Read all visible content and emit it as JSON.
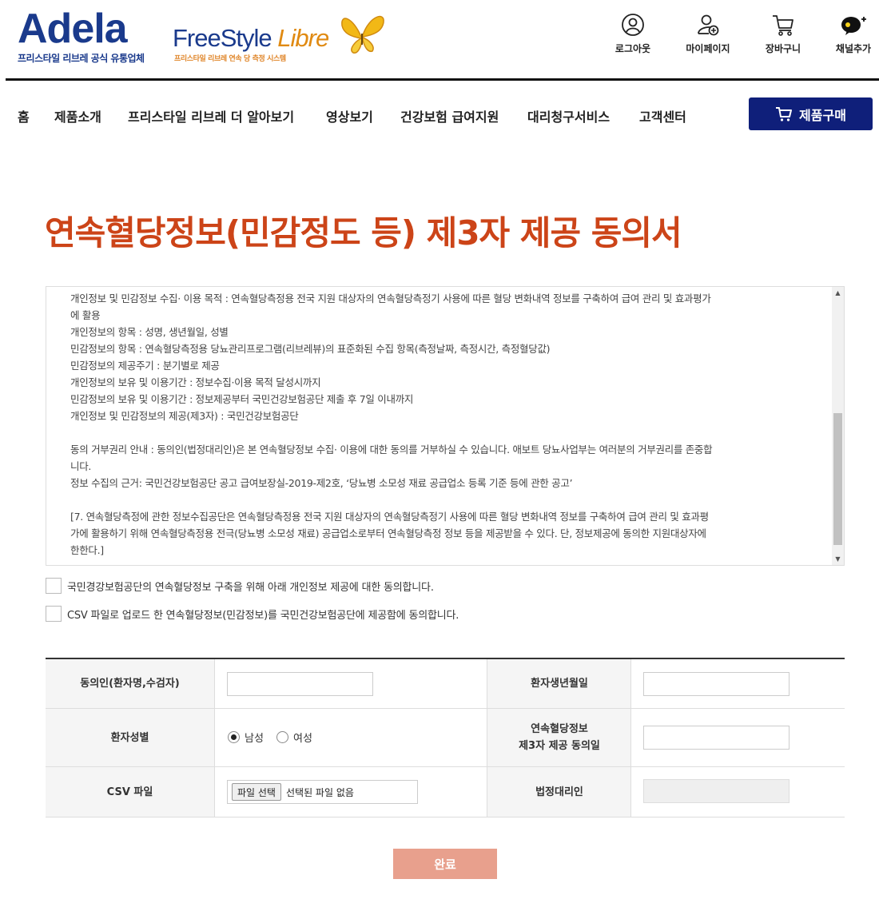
{
  "brand": {
    "adela_name": "Adela",
    "adela_tagline": "프리스타일 리브레 공식 유통업체",
    "libre_name": "FreeStyle",
    "libre_accent": "Libre",
    "libre_tagline": "프리스타일 리브레 연속 당 측정 시스템"
  },
  "utility": [
    {
      "label": "로그아웃",
      "icon": "user-icon"
    },
    {
      "label": "마이페이지",
      "icon": "user-plus-icon"
    },
    {
      "label": "장바구니",
      "icon": "cart-icon"
    },
    {
      "label": "채널추가",
      "icon": "kakao-channel-icon",
      "badge": "Ch"
    }
  ],
  "nav": {
    "items": [
      "홈",
      "제품소개",
      "프리스타일 리브레 더 알아보기",
      "영상보기",
      "건강보험 급여지원",
      "대리청구서비스",
      "고객센터"
    ],
    "buy_label": "제품구매"
  },
  "page_title": "연속혈당정보(민감정도 등) 제3자 제공 동의서",
  "terms": {
    "lines": [
      "개인정보 및 민감정보 수집· 이용 목적 : 연속혈당측정용 전국 지원 대상자의 연속혈당측정기 사용에 따른 혈당 변화내역 정보를 구축하여 급여 관리 및 효과평가",
      "에 활용",
      "개인정보의 항목 : 성명, 생년월일, 성별",
      "민감정보의 항목 : 연속혈당측정용 당뇨관리프로그램(리브레뷰)의 표준화된 수집 항목(측정날짜, 측정시간, 측정혈당값)",
      "민감정보의 제공주기 : 분기별로 제공",
      "개인정보의 보유 및 이용기간 : 정보수집·이용 목적 달성시까지",
      "민감정보의 보유 및 이용기간 : 정보제공부터 국민건강보험공단 제출 후 7일 이내까지",
      "개인정보 및 민감정보의 제공(제3자) : 국민건강보험공단",
      "",
      "동의 거부권리 안내 : 동의인(법정대리인)은 본 연속혈당정보 수집· 이용에 대한 동의를 거부하실 수 있습니다. 애보트 당뇨사업부는 여러분의 거부권리를 존중합",
      "니다.",
      "정보 수집의 근거: 국민건강보험공단 공고 급여보장실-2019-제2호, ‘당뇨병 소모성 재료 공급업소 등록 기준 등에 관한 공고’",
      "",
      "[7. 연속혈당측정에 관한 정보수집공단은 연속혈당측정용 전국 지원 대상자의 연속혈당측정기 사용에 따른 혈당 변화내역 정보를 구축하여 급여 관리 및 효과평",
      "가에 활용하기 위해 연속혈당측정용 전극(당뇨병 소모성 재료) 공급업소로부터 연속혈당측정 정보 등을 제공받을 수 있다. 단, 정보제공에 동의한 지원대상자에",
      "한한다.]"
    ]
  },
  "agreements": [
    "국민경강보험공단의 연속혈당정보 구축을 위해 아래 개인정보 제공에 대한 동의합니다.",
    "CSV 파일로 업로드 한 연속혈당정보(민감정보)를 국민건강보험공단에 제공함에 동의합니다."
  ],
  "form": {
    "consenter_label": "동의인(환자명,수검자)",
    "birth_label": "환자생년월일",
    "gender_label": "환자성별",
    "gender_options": [
      "남성",
      "여성"
    ],
    "gender_selected": "남성",
    "consent_date_label_line1": "연속혈당정보",
    "consent_date_label_line2": "제3자 제공 동의일",
    "csv_label": "CSV 파일",
    "file_button": "파일 선택",
    "file_status": "선택된 파일 없음",
    "guardian_label": "법정대리인"
  },
  "submit_label": "완료",
  "colors": {
    "brand_blue": "#1a3a8c",
    "nav_button": "#0f1f7a",
    "title_red": "#cc4418",
    "submit": "#e8a08d"
  }
}
